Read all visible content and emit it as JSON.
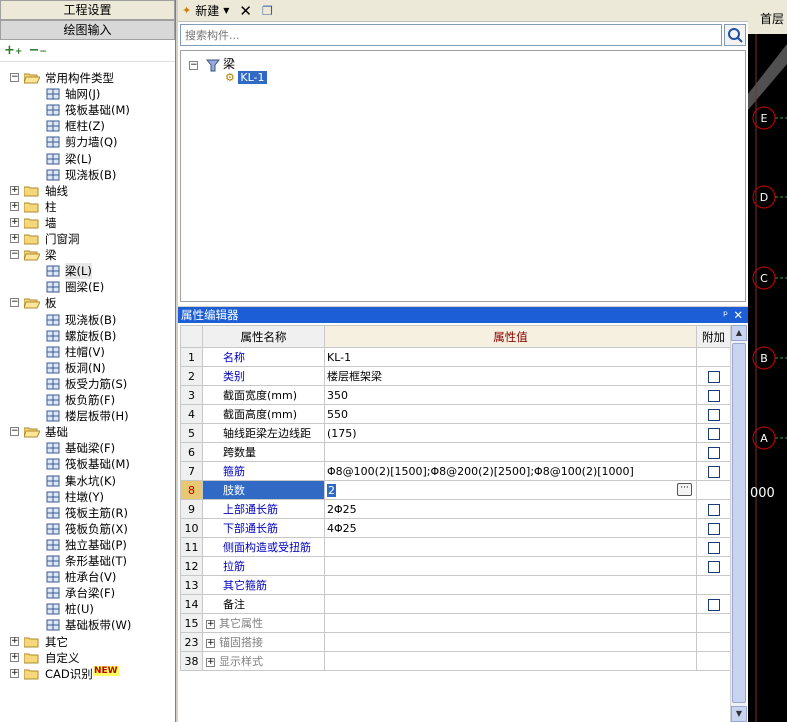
{
  "left_panel": {
    "tabs": [
      "工程设置",
      "绘图输入"
    ],
    "tree": [
      {
        "label": "常用构件类型",
        "level": 0,
        "type": "folder",
        "expanded": true
      },
      {
        "label": "轴网(J)",
        "level": 1,
        "icon": "grid-icon"
      },
      {
        "label": "筏板基础(M)",
        "level": 1,
        "icon": "raft-foundation-icon"
      },
      {
        "label": "框柱(Z)",
        "level": 1,
        "icon": "column-icon"
      },
      {
        "label": "剪力墙(Q)",
        "level": 1,
        "icon": "shear-wall-icon"
      },
      {
        "label": "梁(L)",
        "level": 1,
        "icon": "beam-icon"
      },
      {
        "label": "现浇板(B)",
        "level": 1,
        "icon": "slab-icon"
      },
      {
        "label": "轴线",
        "level": 0,
        "type": "folder",
        "expanded": false
      },
      {
        "label": "柱",
        "level": 0,
        "type": "folder",
        "expanded": false
      },
      {
        "label": "墙",
        "level": 0,
        "type": "folder",
        "expanded": false
      },
      {
        "label": "门窗洞",
        "level": 0,
        "type": "folder",
        "expanded": false
      },
      {
        "label": "梁",
        "level": 0,
        "type": "folder",
        "expanded": true
      },
      {
        "label": "梁(L)",
        "level": 1,
        "icon": "beam-icon",
        "selected": true
      },
      {
        "label": "圈梁(E)",
        "level": 1,
        "icon": "ring-beam-icon"
      },
      {
        "label": "板",
        "level": 0,
        "type": "folder",
        "expanded": true
      },
      {
        "label": "现浇板(B)",
        "level": 1,
        "icon": "slab-icon"
      },
      {
        "label": "螺旋板(B)",
        "level": 1,
        "icon": "spiral-slab-icon"
      },
      {
        "label": "柱帽(V)",
        "level": 1,
        "icon": "column-cap-icon"
      },
      {
        "label": "板洞(N)",
        "level": 1,
        "icon": "slab-hole-icon"
      },
      {
        "label": "板受力筋(S)",
        "level": 1,
        "icon": "slab-rebar-icon"
      },
      {
        "label": "板负筋(F)",
        "level": 1,
        "icon": "slab-neg-rebar-icon"
      },
      {
        "label": "楼层板带(H)",
        "level": 1,
        "icon": "slab-strip-icon"
      },
      {
        "label": "基础",
        "level": 0,
        "type": "folder",
        "expanded": true
      },
      {
        "label": "基础梁(F)",
        "level": 1,
        "icon": "foundation-beam-icon"
      },
      {
        "label": "筏板基础(M)",
        "level": 1,
        "icon": "raft-foundation-icon"
      },
      {
        "label": "集水坑(K)",
        "level": 1,
        "icon": "sump-pit-icon"
      },
      {
        "label": "柱墩(Y)",
        "level": 1,
        "icon": "column-pier-icon"
      },
      {
        "label": "筏板主筋(R)",
        "level": 1,
        "icon": "raft-main-rebar-icon"
      },
      {
        "label": "筏板负筋(X)",
        "level": 1,
        "icon": "raft-neg-rebar-icon"
      },
      {
        "label": "独立基础(P)",
        "level": 1,
        "icon": "isolated-footing-icon"
      },
      {
        "label": "条形基础(T)",
        "level": 1,
        "icon": "strip-footing-icon"
      },
      {
        "label": "桩承台(V)",
        "level": 1,
        "icon": "pile-cap-icon"
      },
      {
        "label": "承台梁(F)",
        "level": 1,
        "icon": "cap-beam-icon"
      },
      {
        "label": "桩(U)",
        "level": 1,
        "icon": "pile-icon"
      },
      {
        "label": "基础板带(W)",
        "level": 1,
        "icon": "foundation-strip-icon"
      },
      {
        "label": "其它",
        "level": 0,
        "type": "folder",
        "expanded": false
      },
      {
        "label": "自定义",
        "level": 0,
        "type": "folder",
        "expanded": false
      },
      {
        "label": "CAD识别",
        "level": 0,
        "type": "folder",
        "expanded": false,
        "badge": "NEW"
      }
    ]
  },
  "toolbar": {
    "new_label": "新建"
  },
  "search": {
    "placeholder": "搜索构件..."
  },
  "component_tree": {
    "root": "梁",
    "child": "KL-1"
  },
  "property_editor": {
    "title": "属性编辑器",
    "col_name": "属性名称",
    "col_value": "属性值",
    "col_add": "附加",
    "rows": [
      {
        "num": "1",
        "name": "名称",
        "value": "KL-1",
        "blue": true,
        "checkbox": false
      },
      {
        "num": "2",
        "name": "类别",
        "value": "楼层框架梁",
        "blue": true,
        "checkbox": true
      },
      {
        "num": "3",
        "name": "截面宽度(mm)",
        "value": "350",
        "blue": false,
        "checkbox": true
      },
      {
        "num": "4",
        "name": "截面高度(mm)",
        "value": "550",
        "blue": false,
        "checkbox": true
      },
      {
        "num": "5",
        "name": "轴线距梁左边线距",
        "value": "(175)",
        "blue": false,
        "checkbox": true
      },
      {
        "num": "6",
        "name": "跨数量",
        "value": "",
        "blue": false,
        "checkbox": true
      },
      {
        "num": "7",
        "name": "箍筋",
        "value": "Φ8@100(2)[1500];Φ8@200(2)[2500];Φ8@100(2)[1000]",
        "blue": true,
        "checkbox": true
      },
      {
        "num": "8",
        "name": "肢数",
        "value": "2",
        "blue": true,
        "checkbox": false,
        "selected": true
      },
      {
        "num": "9",
        "name": "上部通长筋",
        "value": "2Φ25",
        "blue": true,
        "checkbox": true
      },
      {
        "num": "10",
        "name": "下部通长筋",
        "value": "4Φ25",
        "blue": true,
        "checkbox": true
      },
      {
        "num": "11",
        "name": "侧面构造或受扭筋",
        "value": "",
        "blue": true,
        "checkbox": true
      },
      {
        "num": "12",
        "name": "拉筋",
        "value": "",
        "blue": true,
        "checkbox": true
      },
      {
        "num": "13",
        "name": "其它箍筋",
        "value": "",
        "blue": true,
        "checkbox": false
      },
      {
        "num": "14",
        "name": "备注",
        "value": "",
        "blue": false,
        "checkbox": true
      },
      {
        "num": "15",
        "name": "其它属性",
        "value": "",
        "group": true
      },
      {
        "num": "23",
        "name": "锚固搭接",
        "value": "",
        "group": true
      },
      {
        "num": "38",
        "name": "显示样式",
        "value": "",
        "group": true
      }
    ]
  },
  "cad_view": {
    "tab": "首层",
    "axis_labels": [
      "E",
      "D",
      "C",
      "B",
      "A"
    ],
    "dimension_text": "000"
  },
  "colors": {
    "title_blue": "#1c5ed6",
    "axis_red": "#cc0000",
    "link_blue": "#0000c0"
  }
}
